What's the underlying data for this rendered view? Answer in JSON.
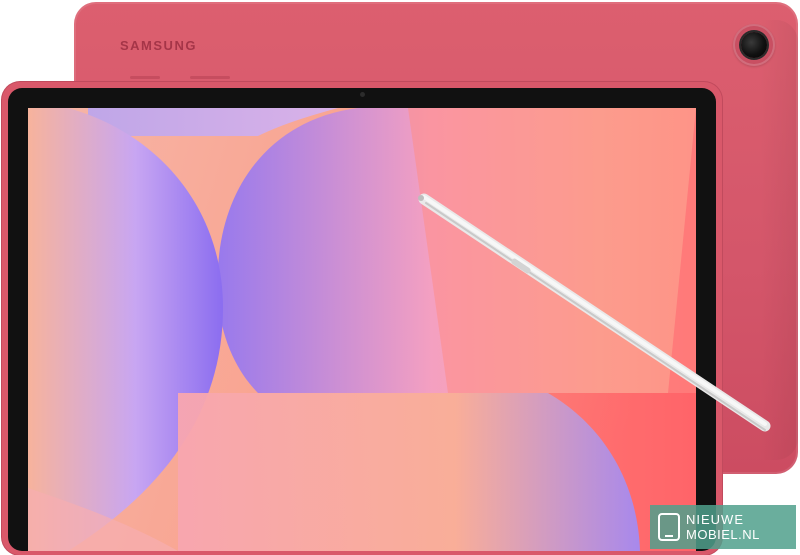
{
  "device": {
    "brand_logo": "SAMSUNG",
    "colors": {
      "body": "#d9586a",
      "bezel": "#111111",
      "pen": "#ececec"
    }
  },
  "wallpaper": {
    "colors": {
      "peach": "#f7b49a",
      "coral": "#ff6e6e",
      "violet": "#9c78f2",
      "lavender": "#c5a7f3"
    }
  },
  "watermark": {
    "line1": "NIEUWE",
    "line2": "MOBIEL.NL"
  }
}
